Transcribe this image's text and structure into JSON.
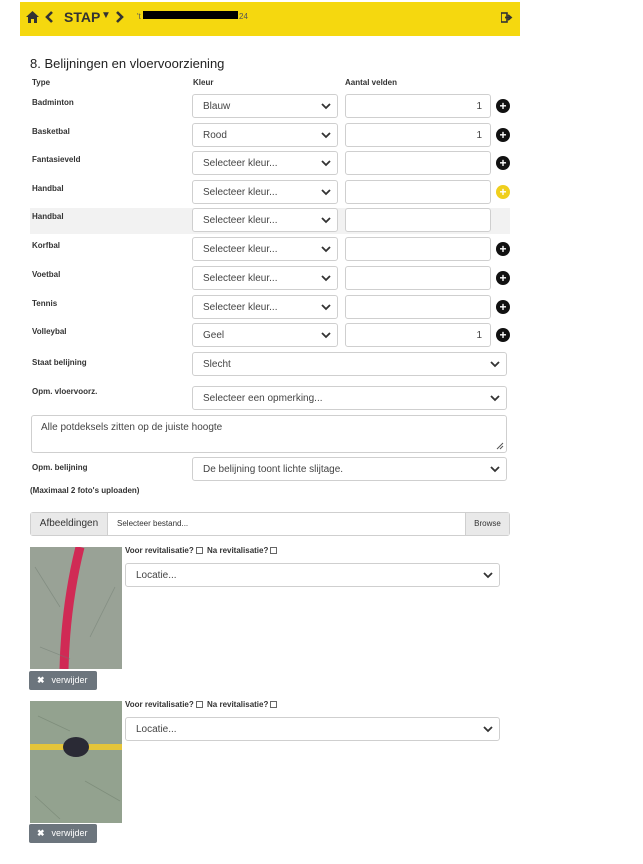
{
  "topbar": {
    "stap_label": "STAP",
    "breadcrumb_prefix": "'t",
    "breadcrumb_suffix": "24",
    "icons": [
      "home-icon",
      "chevron-left-icon",
      "caret-down-icon",
      "chevron-right-icon",
      "logout-icon"
    ]
  },
  "section": {
    "title": "8. Belijningen en vloervoorziening"
  },
  "columns": {
    "type": "Type",
    "color": "Kleur",
    "fields": "Aantal velden"
  },
  "rows": [
    {
      "type": "Badminton",
      "color": "Blauw",
      "count": "1",
      "plus": "black"
    },
    {
      "type": "Basketbal",
      "color": "Rood",
      "count": "1",
      "plus": "black"
    },
    {
      "type": "Fantasieveld",
      "color": "Selecteer kleur...",
      "count": "",
      "plus": "black"
    },
    {
      "type": "Handbal",
      "color": "Selecteer kleur...",
      "count": "",
      "plus": "yellow"
    },
    {
      "type": "Handbal",
      "color": "Selecteer kleur...",
      "count": "",
      "plus": "none"
    },
    {
      "type": "Korfbal",
      "color": "Selecteer kleur...",
      "count": "",
      "plus": "black"
    },
    {
      "type": "Voetbal",
      "color": "Selecteer kleur...",
      "count": "",
      "plus": "black"
    },
    {
      "type": "Tennis",
      "color": "Selecteer kleur...",
      "count": "",
      "plus": "black"
    },
    {
      "type": "Volleybal",
      "color": "Geel",
      "count": "1",
      "plus": "black"
    }
  ],
  "staat": {
    "label": "Staat belijning",
    "value": "Slecht"
  },
  "vloervoorz": {
    "label": "Opm. vloervoorz.",
    "value": "Selecteer een opmerking...",
    "note": "Alle potdeksels zitten op de juiste hoogte"
  },
  "belijning": {
    "label": "Opm. belijning",
    "value": "De belijning toont lichte slijtage."
  },
  "upload": {
    "note": "(Maximaal 2 foto's uploaden)",
    "tag": "Afbeeldingen",
    "file_placeholder": "Selecteer bestand...",
    "browse": "Browse"
  },
  "photos": [
    {
      "voor": "Voor revitalisatie?",
      "na": "Na revitalisatie?",
      "location": "Locatie...",
      "delete": "verwijder"
    },
    {
      "voor": "Voor revitalisatie?",
      "na": "Na revitalisatie?",
      "location": "Locatie...",
      "delete": "verwijder"
    }
  ]
}
